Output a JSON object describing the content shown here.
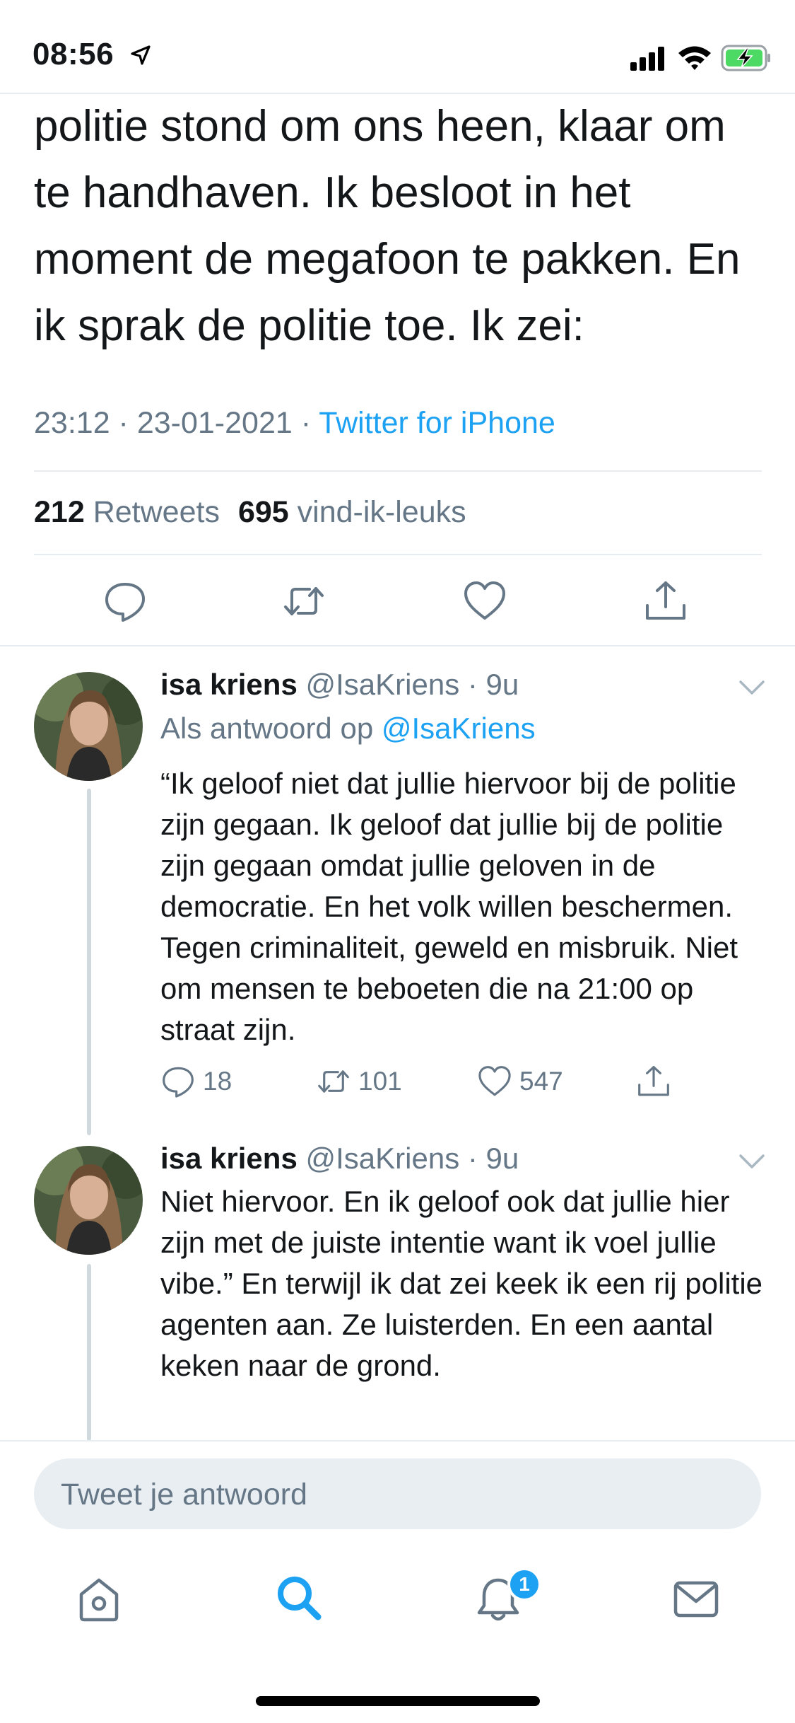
{
  "status_bar": {
    "time": "08:56",
    "icons": [
      "location-arrow-icon",
      "cellular-signal-icon",
      "wifi-icon",
      "battery-charging-icon"
    ],
    "battery_color": "#4cd964"
  },
  "main_tweet": {
    "text": "politie stond om ons heen, klaar om te handhaven. Ik besloot in het moment de megafoon te pakken. En ik sprak de politie toe. Ik zei:",
    "timestamp": "23:12 · 23-01-2021 · ",
    "source": "Twitter for iPhone",
    "retweets_count": "212",
    "retweets_label": "Retweets",
    "likes_count": "695",
    "likes_label": "vind-ik-leuks",
    "actions": [
      "reply-icon",
      "retweet-icon",
      "like-icon",
      "share-icon"
    ]
  },
  "replies": [
    {
      "name": "isa kriens",
      "handle": "@IsaKriens · 9u",
      "reply_to_label": "Als antwoord op ",
      "reply_to_handle": "@IsaKriens",
      "text": "“Ik geloof niet dat jullie hiervoor bij de politie zijn gegaan. Ik geloof dat jullie bij de politie zijn gegaan omdat jullie geloven in de democratie. En het volk willen beschermen. Tegen criminaliteit, geweld en misbruik. Niet om mensen te beboeten die na 21:00 op straat zijn.",
      "reply_count": "18",
      "retweet_count": "101",
      "like_count": "547"
    },
    {
      "name": "isa kriens",
      "handle": "@IsaKriens · 9u",
      "text": "Niet hiervoor. En ik geloof ook dat jullie hier zijn met de juiste intentie want ik voel jullie vibe.” En terwijl ik dat zei keek ik een rij politie agenten aan. Ze luisterden. En een aantal keken naar de grond."
    }
  ],
  "composer": {
    "placeholder": "Tweet je antwoord"
  },
  "tab_bar": {
    "tabs": [
      "home-icon",
      "search-icon",
      "notifications-icon",
      "messages-icon"
    ],
    "active_tab": "search-icon",
    "notification_badge": "1"
  },
  "colors": {
    "accent": "#1da1f2",
    "text_primary": "#14171a",
    "text_secondary": "#657786",
    "divider": "#e6ecf0"
  }
}
